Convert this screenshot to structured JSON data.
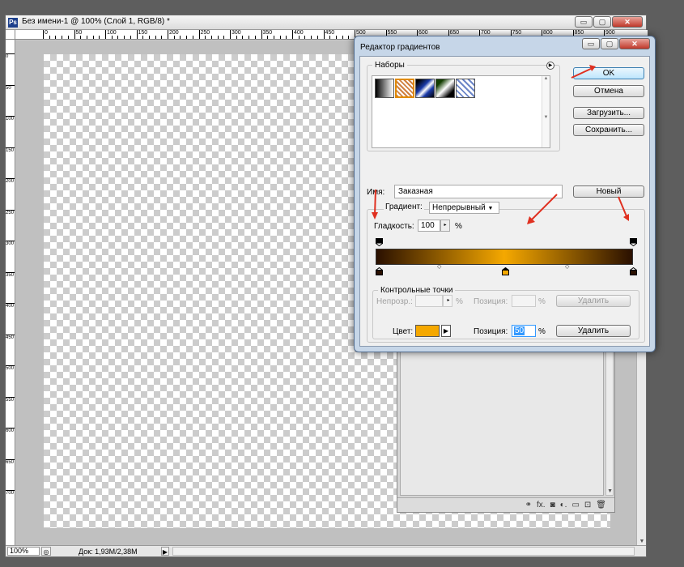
{
  "document": {
    "title": "Без имени-1 @ 100% (Слой 1, RGB/8) *",
    "ps_icon": "Ps",
    "zoom": "100%",
    "doc_size": "Док: 1,93M/2,38M",
    "ruler_top_labels": [
      "0",
      "50",
      "100",
      "150",
      "200",
      "250",
      "300",
      "350",
      "400",
      "450",
      "500",
      "550",
      "600",
      "650",
      "700",
      "750",
      "800",
      "850",
      "900"
    ],
    "ruler_left_labels": [
      "0",
      "50",
      "100",
      "150",
      "200",
      "250",
      "300",
      "350",
      "400",
      "450",
      "500",
      "550",
      "600",
      "650",
      "700"
    ],
    "window_buttons": {
      "minimize": "▭",
      "maximize": "▢",
      "close": "✕"
    }
  },
  "layers_panel": {
    "toolbar_icons": [
      "link-icon",
      "fx-icon",
      "mask-icon",
      "adjustment-icon",
      "group-icon",
      "new-layer-icon",
      "trash-icon"
    ],
    "toolbar_glyphs": [
      "⚭",
      "fx.",
      "◙",
      "◐.",
      "▭",
      "⊡",
      "🗑"
    ]
  },
  "dialog": {
    "title": "Редактор градиентов",
    "presets_label": "Наборы",
    "ok": "OK",
    "cancel": "Отмена",
    "load": "Загрузить...",
    "save": "Сохранить...",
    "name_label": "Имя:",
    "name_value": "Заказная",
    "new_button": "Новый",
    "gradient_type_label": "Градиент:",
    "gradient_type_value": "Непрерывный",
    "smoothness_label": "Гладкость:",
    "smoothness_value": "100",
    "smoothness_unit": "%",
    "control_points_label": "Контрольные точки",
    "opacity_label": "Непрозр.:",
    "opacity_unit": "%",
    "position_label_1": "Позиция:",
    "position_unit_1": "%",
    "delete_1": "Удалить",
    "color_label": "Цвет:",
    "position_label_2": "Позиция:",
    "position_value_2": "50",
    "position_unit_2": "%",
    "delete_2": "Удалить",
    "gradient_colors": {
      "start": "#2a1000",
      "middle": "#f5a800",
      "end": "#2a1000"
    },
    "selected_color": "#f5a800",
    "accent_arrow_color": "#e03020"
  }
}
